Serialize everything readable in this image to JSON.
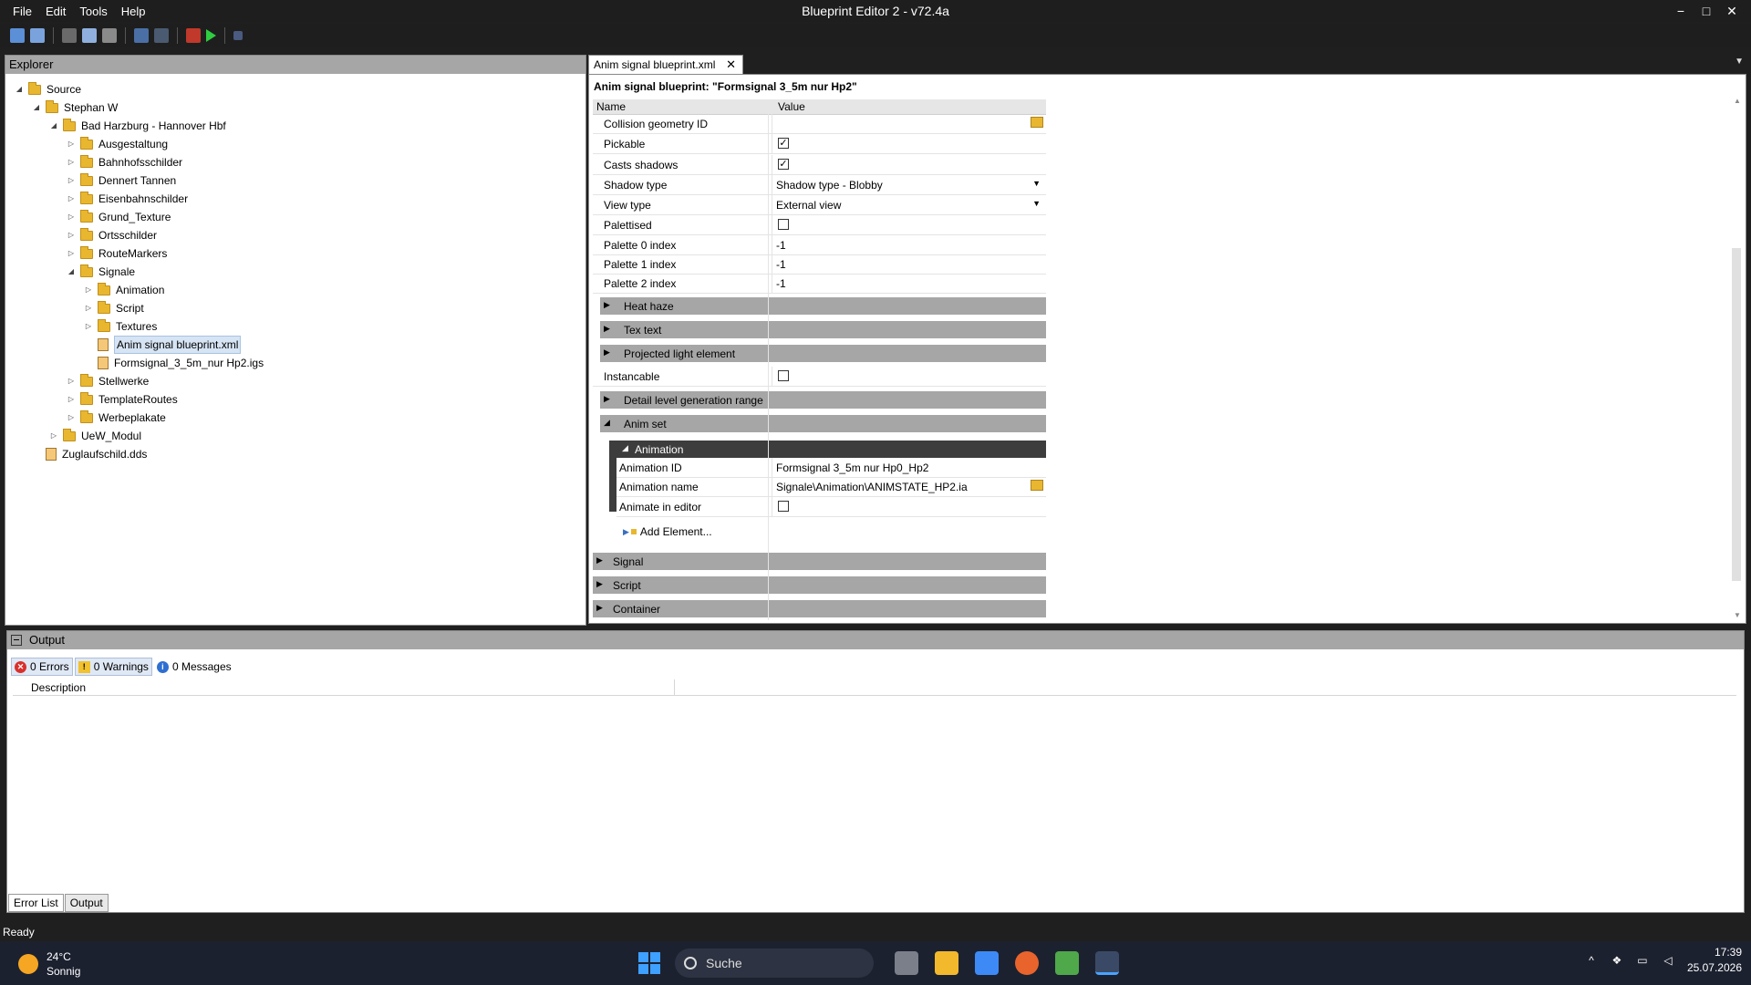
{
  "window": {
    "title": "Blueprint Editor 2 - v72.4a",
    "menu": [
      "File",
      "Edit",
      "Tools",
      "Help"
    ],
    "controls": {
      "minimize": "−",
      "maximize": "□",
      "close": "✕"
    }
  },
  "explorer": {
    "header": "Explorer",
    "tree": [
      {
        "label": "Source",
        "level": 0,
        "type": "folder",
        "expanded": true
      },
      {
        "label": "Stephan W",
        "level": 1,
        "type": "folder",
        "expanded": true
      },
      {
        "label": "Bad Harzburg - Hannover Hbf",
        "level": 2,
        "type": "folder",
        "expanded": true
      },
      {
        "label": "Ausgestaltung",
        "level": 3,
        "type": "folder",
        "expanded": false
      },
      {
        "label": "Bahnhofsschilder",
        "level": 3,
        "type": "folder",
        "expanded": false
      },
      {
        "label": "Dennert Tannen",
        "level": 3,
        "type": "folder",
        "expanded": false
      },
      {
        "label": "Eisenbahnschilder",
        "level": 3,
        "type": "folder",
        "expanded": false
      },
      {
        "label": "Grund_Texture",
        "level": 3,
        "type": "folder",
        "expanded": false
      },
      {
        "label": "Ortsschilder",
        "level": 3,
        "type": "folder",
        "expanded": false
      },
      {
        "label": "RouteMarkers",
        "level": 3,
        "type": "folder",
        "expanded": false
      },
      {
        "label": "Signale",
        "level": 3,
        "type": "folder",
        "expanded": true
      },
      {
        "label": "Animation",
        "level": 4,
        "type": "folder",
        "expanded": false
      },
      {
        "label": "Script",
        "level": 4,
        "type": "folder",
        "expanded": false
      },
      {
        "label": "Textures",
        "level": 4,
        "type": "folder",
        "expanded": false
      },
      {
        "label": "Anim signal blueprint.xml",
        "level": 4,
        "type": "file",
        "selected": true
      },
      {
        "label": "Formsignal_3_5m_nur Hp2.igs",
        "level": 4,
        "type": "file"
      },
      {
        "label": "Stellwerke",
        "level": 3,
        "type": "folder",
        "expanded": false
      },
      {
        "label": "TemplateRoutes",
        "level": 3,
        "type": "folder",
        "expanded": false
      },
      {
        "label": "Werbeplakate",
        "level": 3,
        "type": "folder",
        "expanded": false
      },
      {
        "label": "UeW_Modul",
        "level": 2,
        "type": "folder",
        "expanded": false
      },
      {
        "label": "Zuglaufschild.dds",
        "level": 1,
        "type": "file"
      }
    ]
  },
  "editor": {
    "tab_label": "Anim signal blueprint.xml",
    "blueprint_title": "Anim signal blueprint: \"Formsignal 3_5m nur Hp2\"",
    "columns": {
      "name": "Name",
      "value": "Value"
    },
    "properties": {
      "collision": {
        "name": "Collision geometry ID",
        "value": ""
      },
      "pickable": {
        "name": "Pickable",
        "checked": "✓"
      },
      "casts_shadows": {
        "name": "Casts shadows",
        "checked": "✓"
      },
      "shadow_type": {
        "name": "Shadow type",
        "value": "Shadow type - Blobby"
      },
      "view_type": {
        "name": "View type",
        "value": "External view"
      },
      "palettised": {
        "name": "Palettised",
        "checked": ""
      },
      "palette0": {
        "name": "Palette 0 index",
        "value": "-1"
      },
      "palette1": {
        "name": "Palette 1 index",
        "value": "-1"
      },
      "palette2": {
        "name": "Palette 2 index",
        "value": "-1"
      },
      "instancable": {
        "name": "Instancable",
        "checked": ""
      }
    },
    "groups": {
      "heat_haze": "Heat haze",
      "tex_text": "Tex text",
      "projected_light": "Projected light element",
      "detail_level": "Detail level generation range",
      "anim_set": "Anim set",
      "signal": "Signal",
      "script": "Script",
      "container": "Container"
    },
    "animation": {
      "header": "Animation",
      "id": {
        "name": "Animation ID",
        "value": "Formsignal 3_5m nur Hp0_Hp2"
      },
      "name": {
        "name": "Animation name",
        "value": "Signale\\Animation\\ANIMSTATE_HP2.ia"
      },
      "in_editor": {
        "name": "Animate in editor",
        "checked": ""
      },
      "add_element": "Add Element..."
    }
  },
  "output": {
    "header": "Output",
    "errors": "0 Errors",
    "warnings": "0 Warnings",
    "messages": "0 Messages",
    "description_col": "Description",
    "tabs": [
      "Error List",
      "Output"
    ]
  },
  "status": "Ready",
  "taskbar": {
    "weather_temp": "24°C",
    "weather_desc": "Sonnig",
    "search_placeholder": "Suche",
    "time": "17:39",
    "date": "25.07.2026"
  }
}
